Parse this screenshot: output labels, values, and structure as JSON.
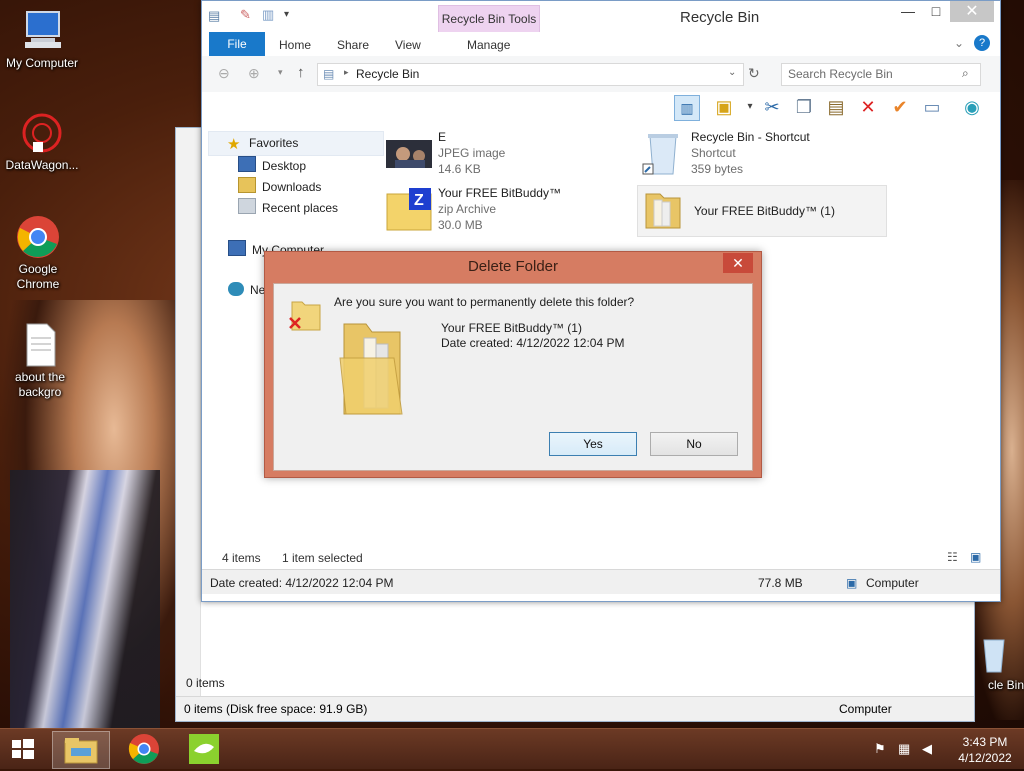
{
  "desktop": {
    "icons": [
      {
        "label": "My Computer"
      },
      {
        "label": "DataWagon..."
      },
      {
        "label": "Google Chrome"
      },
      {
        "label": "about the backgro"
      },
      {
        "label": "cle Bin"
      }
    ]
  },
  "back_window": {
    "status_items": "0 items",
    "status_free": "0 items (Disk free space: 91.9 GB)",
    "status_location": "Computer"
  },
  "window": {
    "title": "Recycle Bin",
    "context_tab": "Recycle Bin Tools",
    "ribbon_tabs": [
      "File",
      "Home",
      "Share",
      "View",
      "Manage"
    ],
    "address": "Recycle Bin",
    "search_placeholder": "Search Recycle Bin",
    "nav": {
      "favorites": "Favorites",
      "desktop": "Desktop",
      "downloads": "Downloads",
      "recent": "Recent places",
      "computer": "My Computer",
      "network": "Ne"
    },
    "files": [
      {
        "name": "E",
        "type": "JPEG image",
        "size": "14.6 KB"
      },
      {
        "name": "Recycle Bin - Shortcut",
        "type": "Shortcut",
        "size": "359 bytes"
      },
      {
        "name": "Your FREE BitBuddy™",
        "type": "zip Archive",
        "size": "30.0 MB"
      },
      {
        "name": "Your FREE BitBuddy™ (1)",
        "type": "",
        "size": ""
      }
    ],
    "status": {
      "count": "4 items",
      "selected": "1 item selected",
      "date_created": "Date created: 4/12/2022 12:04 PM",
      "size": "77.8 MB",
      "location": "Computer"
    }
  },
  "dialog": {
    "title": "Delete Folder",
    "question": "Are you sure you want to permanently delete this folder?",
    "item_name": "Your FREE BitBuddy™ (1)",
    "item_date": "Date created: 4/12/2022 12:04 PM",
    "yes_label": "Yes",
    "no_label": "No"
  },
  "taskbar": {
    "time": "3:43 PM",
    "date": "4/12/2022"
  }
}
